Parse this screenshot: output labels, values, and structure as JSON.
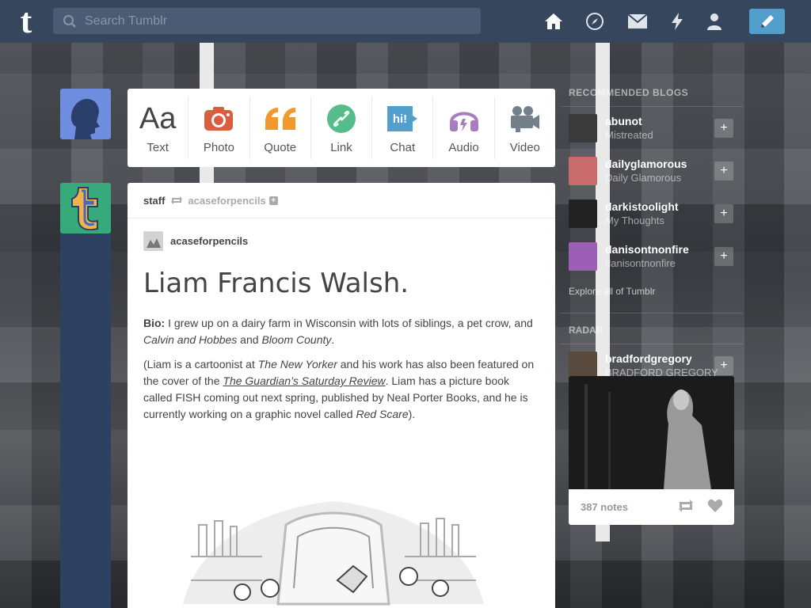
{
  "colors": {
    "navy": "#36465d",
    "accent_blue": "#529ecc",
    "photo": "#d95e40",
    "quote": "#f2992e",
    "link": "#56bc8a",
    "chat": "#529ecc",
    "audio": "#a77dc2",
    "video": "#748089"
  },
  "topbar": {
    "search_placeholder": "Search Tumblr",
    "icons": [
      "home-icon",
      "compass-icon",
      "mail-icon",
      "lightning-icon",
      "account-icon",
      "pencil-icon"
    ]
  },
  "post_types": [
    {
      "label": "Text",
      "icon": "text-icon"
    },
    {
      "label": "Photo",
      "icon": "camera-icon"
    },
    {
      "label": "Quote",
      "icon": "quote-icon"
    },
    {
      "label": "Link",
      "icon": "link-icon"
    },
    {
      "label": "Chat",
      "icon": "chat-icon"
    },
    {
      "label": "Audio",
      "icon": "headphones-icon"
    },
    {
      "label": "Video",
      "icon": "video-camera-icon"
    }
  ],
  "post": {
    "author": "staff",
    "reblogged_from": "acaseforpencils",
    "reblog_author": "acaseforpencils",
    "title": "Liam Francis Walsh.",
    "bio_label": "Bio:",
    "bio_text": " I grew up on a dairy farm in Wisconsin with lots of siblings, a pet crow, and ",
    "bio_book1": "Calvin and Hobbes",
    "bio_and": " and ",
    "bio_book2": "Bloom County",
    "bio_end": ".",
    "p2_a": "(Liam is a cartoonist at ",
    "p2_newyorker": "The New Yorker",
    "p2_b": " and his work has also been featured on the cover of the ",
    "p2_guardian": "The Guardian’s Saturday Review",
    "p2_c": ". Liam has a picture book called FISH coming out next spring, published by Neal Porter Books, and he is currently working on a graphic novel called ",
    "p2_redscare": "Red Scare",
    "p2_d": ")."
  },
  "sidebar": {
    "recommended_heading": "RECOMMENDED BLOGS",
    "blogs": [
      {
        "name": "abunot",
        "sub": "Mistreated"
      },
      {
        "name": "dailyglamorous",
        "sub": "Daily Glamorous"
      },
      {
        "name": "darkistoolight",
        "sub": "My Thoughts"
      },
      {
        "name": "danisontnonfire",
        "sub": "danisontnonfire"
      }
    ],
    "explore": "Explore all of Tumblr",
    "radar_heading": "RADAR",
    "radar_blog": {
      "name": "bradfordgregory",
      "sub": "BRADFORD GREGORY"
    },
    "radar_notes": "387 notes"
  }
}
